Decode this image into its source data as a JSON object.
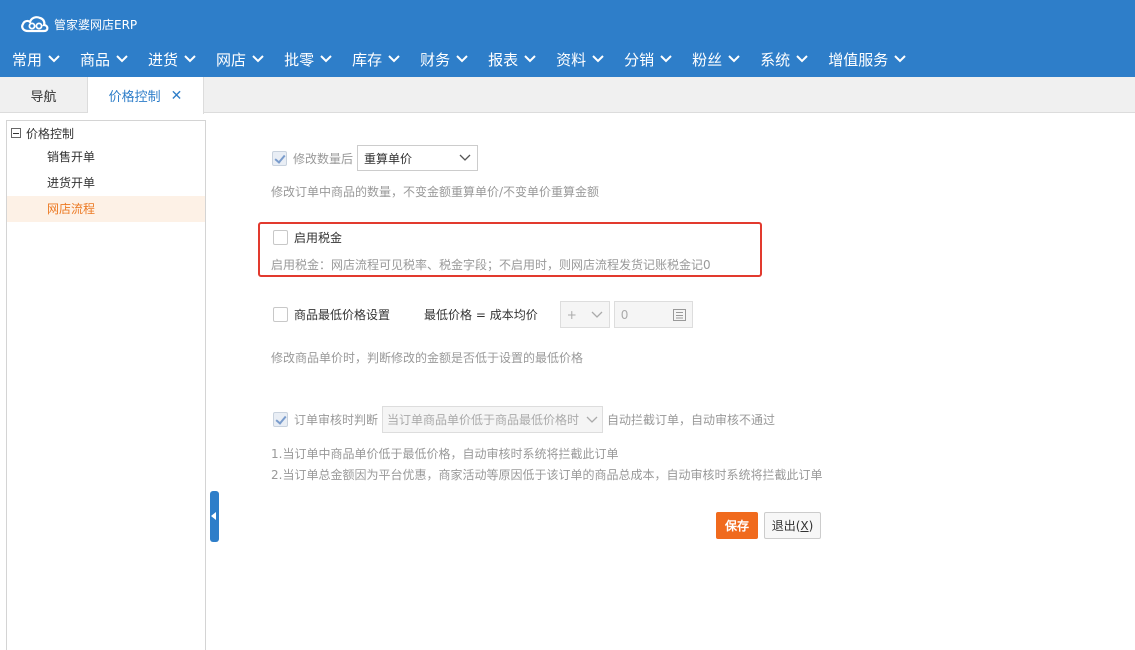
{
  "app": {
    "title": "管家婆网店ERP"
  },
  "menu": [
    {
      "label": "常用"
    },
    {
      "label": "商品"
    },
    {
      "label": "进货"
    },
    {
      "label": "网店"
    },
    {
      "label": "批零"
    },
    {
      "label": "库存"
    },
    {
      "label": "财务"
    },
    {
      "label": "报表"
    },
    {
      "label": "资料"
    },
    {
      "label": "分销"
    },
    {
      "label": "粉丝"
    },
    {
      "label": "系统"
    },
    {
      "label": "增值服务"
    }
  ],
  "tabs": {
    "nav_label": "导航",
    "active_label": "价格控制",
    "close_glyph": "✕"
  },
  "tree": {
    "root_label": "价格控制",
    "items": [
      {
        "label": "销售开单"
      },
      {
        "label": "进货开单"
      },
      {
        "label": "网店流程"
      }
    ]
  },
  "settings": {
    "qty": {
      "checkbox_label": "修改数量后",
      "select_value": "重算单价",
      "desc": "修改订单中商品的数量，不变金额重算单价/不变单价重算金额"
    },
    "tax": {
      "checkbox_label": "启用税金",
      "desc": "启用税金：网店流程可见税率、税金字段；不启用时，则网店流程发货记账税金记0"
    },
    "min_price": {
      "checkbox_label": "商品最低价格设置",
      "formula_label": "最低价格 = 成本均价",
      "operator_value": "+",
      "amount_value": "0",
      "desc": "修改商品单价时，判断修改的金额是否低于设置的最低价格"
    },
    "audit": {
      "checkbox_label": "订单审核时判断",
      "select_value": "当订单商品单价低于商品最低价格时",
      "suffix": "自动拦截订单，自动审核不通过",
      "desc1": "1.当订单中商品单价低于最低价格，自动审核时系统将拦截此订单",
      "desc2": "2.当订单总金额因为平台优惠，商家活动等原因低于该订单的商品总成本，自动审核时系统将拦截此订单"
    }
  },
  "buttons": {
    "save": "保存",
    "exit_prefix": "退出(",
    "exit_key": "X",
    "exit_suffix": ")"
  },
  "colors": {
    "brand": "#2e7ec9",
    "accent": "#f06a1d",
    "highlight": "#e23a2e"
  }
}
